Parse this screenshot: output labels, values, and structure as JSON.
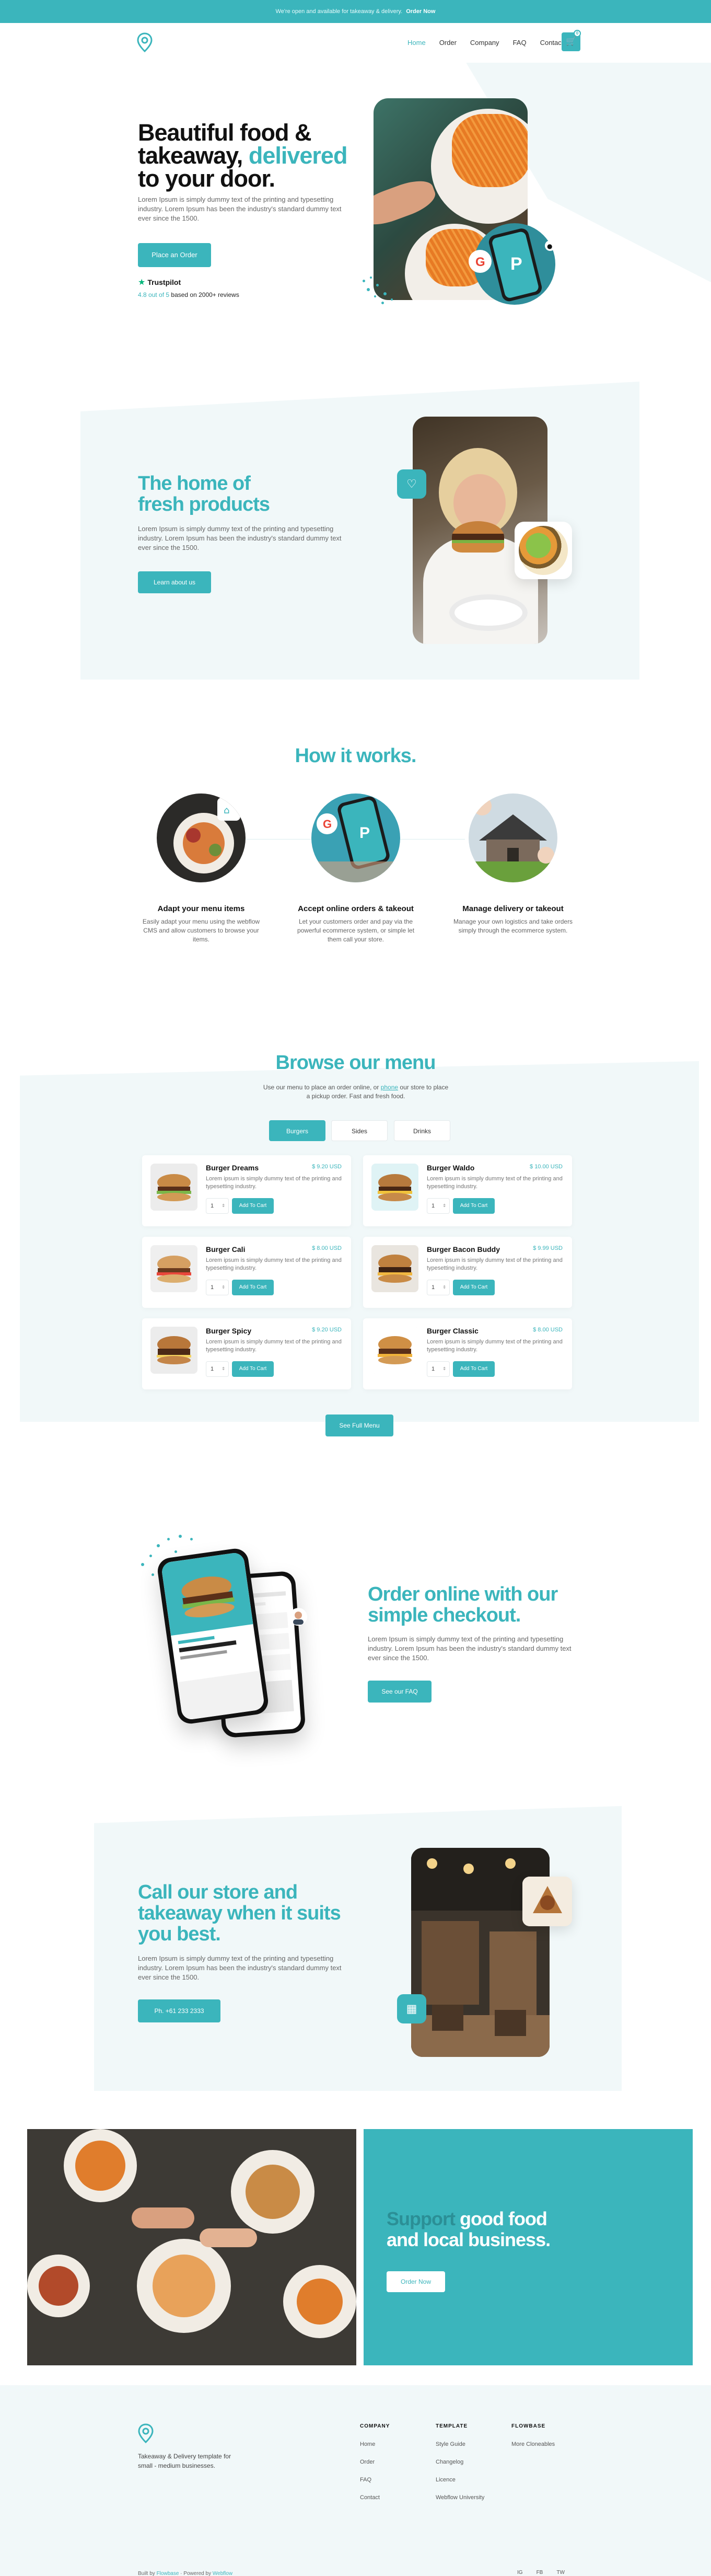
{
  "banner": {
    "text": "We're open and available for takeaway & delivery.",
    "cta": "Order Now"
  },
  "nav": {
    "items": [
      "Home",
      "Order",
      "Company",
      "FAQ",
      "Contact"
    ],
    "cart_count": "0"
  },
  "hero": {
    "title_line1": "Beautiful food &",
    "title_line2_a": "takeaway,",
    "title_line2_b": "delivered",
    "title_line3": "to your door.",
    "text": "Lorem Ipsum is simply dummy text of the printing and typesetting industry. Lorem Ipsum has been the industry's standard dummy text ever since the 1500.",
    "button": "Place an Order",
    "trustpilot": "Trustpilot",
    "rating_score": "4.8 out of 5",
    "rating_rest": "based on 2000+ reviews"
  },
  "fresh": {
    "title_line1": "The home of",
    "title_line2": "fresh products",
    "text": "Lorem Ipsum is simply dummy text of the printing and typesetting industry. Lorem Ipsum has been the industry's standard dummy text ever since the 1500.",
    "button": "Learn about us"
  },
  "how": {
    "title": "How it works.",
    "steps": [
      {
        "title": "Adapt your menu items",
        "text": "Easily adapt your menu using the webflow CMS and allow customers to browse your items."
      },
      {
        "title": "Accept online orders & takeout",
        "text": "Let your customers order and pay via the powerful ecommerce system, or simple let them call your store."
      },
      {
        "title": "Manage delivery or takeout",
        "text": "Manage your own logistics and take orders simply through the ecommerce system."
      }
    ]
  },
  "menu": {
    "title": "Browse our menu",
    "sub_a": "Use our menu to place an order online, or",
    "sub_link": "phone",
    "sub_b": "our store to place a pickup order. Fast and fresh food.",
    "tabs": [
      "Burgers",
      "Sides",
      "Drinks"
    ],
    "add_label": "Add To Cart",
    "qty": "1",
    "items": [
      {
        "name": "Burger Dreams",
        "price": "$ 9.20 USD",
        "desc": "Lorem ipsum is simply dummy text of the printing and typesetting industry."
      },
      {
        "name": "Burger Waldo",
        "price": "$ 10.00 USD",
        "desc": "Lorem ipsum is simply dummy text of the printing and typesetting industry."
      },
      {
        "name": "Burger Cali",
        "price": "$ 8.00 USD",
        "desc": "Lorem ipsum is simply dummy text of the printing and typesetting industry."
      },
      {
        "name": "Burger Bacon Buddy",
        "price": "$ 9.99 USD",
        "desc": "Lorem ipsum is simply dummy text of the printing and typesetting industry."
      },
      {
        "name": "Burger Spicy",
        "price": "$ 9.20 USD",
        "desc": "Lorem ipsum is simply dummy text of the printing and typesetting industry."
      },
      {
        "name": "Burger Classic",
        "price": "$ 8.00 USD",
        "desc": "Lorem ipsum is simply dummy text of the printing and typesetting industry."
      }
    ],
    "button": "See Full Menu"
  },
  "checkout": {
    "title_line1": "Order online with our",
    "title_line2": "simple checkout.",
    "text": "Lorem Ipsum is simply dummy text of the printing and typesetting industry. Lorem Ipsum has been the industry's standard dummy text ever since the 1500.",
    "button": "See our FAQ"
  },
  "call": {
    "title_line1": "Call our store and",
    "title_line2": "takeaway when it suits",
    "title_line3": "you best.",
    "text": "Lorem Ipsum is simply dummy text of the printing and typesetting industry. Lorem Ipsum has been the industry's standard dummy text ever since the 1500.",
    "button": "Ph. +61 233 2333"
  },
  "support": {
    "title_a": "Support",
    "title_b": "good food",
    "title_line2": "and local business.",
    "button": "Order Now"
  },
  "footer": {
    "tagline": "Takeaway & Delivery template for small - medium businesses.",
    "cols": [
      {
        "title": "COMPANY",
        "links": [
          "Home",
          "Order",
          "FAQ",
          "Contact"
        ]
      },
      {
        "title": "TEMPLATE",
        "links": [
          "Style Guide",
          "Changelog",
          "Licence",
          "Webflow University"
        ]
      },
      {
        "title": "FLOWBASE",
        "links": [
          "More Cloneables"
        ]
      }
    ],
    "built_a": "Built by",
    "built_link": "Flowbase",
    "built_b": "· Powered by",
    "powered_link": "Webflow",
    "socials": [
      "IG",
      "FB",
      "TW"
    ]
  },
  "colors": {
    "accent": "#3bb5bc",
    "tint": "#f1f8f9"
  }
}
